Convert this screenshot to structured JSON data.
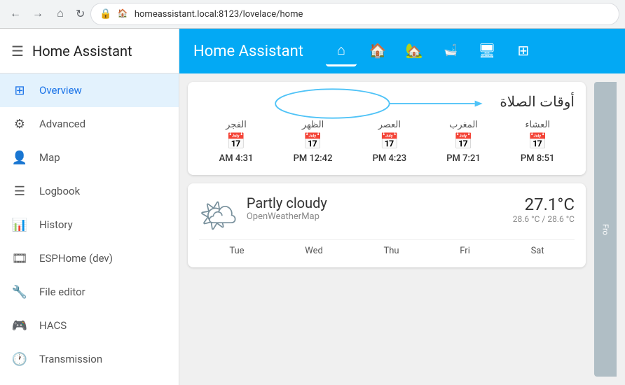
{
  "browser": {
    "back_disabled": false,
    "forward_disabled": true,
    "url": "homeassistant.local:8123/lovelace/home",
    "reload_icon": "↻"
  },
  "sidebar": {
    "title": "Home Assistant",
    "menu_icon": "☰",
    "items": [
      {
        "id": "overview",
        "label": "Overview",
        "icon": "⊞",
        "active": true
      },
      {
        "id": "advanced",
        "label": "Advanced",
        "icon": "⚙",
        "active": false
      },
      {
        "id": "map",
        "label": "Map",
        "icon": "👤",
        "active": false
      },
      {
        "id": "logbook",
        "label": "Logbook",
        "icon": "☰",
        "active": false
      },
      {
        "id": "history",
        "label": "History",
        "icon": "📊",
        "active": false
      },
      {
        "id": "esphome",
        "label": "ESPHome (dev)",
        "icon": "🎞",
        "active": false
      },
      {
        "id": "file-editor",
        "label": "File editor",
        "icon": "🔧",
        "active": false
      },
      {
        "id": "hacs",
        "label": "HACS",
        "icon": "🎮",
        "active": false
      },
      {
        "id": "transmission",
        "label": "Transmission",
        "icon": "🕐",
        "active": false
      }
    ]
  },
  "topbar": {
    "title": "Home Assistant",
    "tabs": [
      {
        "id": "home",
        "icon": "⌂",
        "active": true
      },
      {
        "id": "family",
        "icon": "🏠",
        "active": false
      },
      {
        "id": "house",
        "icon": "🏡",
        "active": false
      },
      {
        "id": "scenes",
        "icon": "🛁",
        "active": false
      },
      {
        "id": "media",
        "icon": "🖥",
        "active": false
      },
      {
        "id": "network",
        "icon": "⊞",
        "active": false
      }
    ]
  },
  "prayer_card": {
    "title": "أوقات الصلاة",
    "prayers": [
      {
        "name": "العشاء",
        "time": "8:51 PM"
      },
      {
        "name": "المغرب",
        "time": "7:21 PM"
      },
      {
        "name": "العصر",
        "time": "4:23 PM"
      },
      {
        "name": "الظهر",
        "time": "12:42 PM"
      },
      {
        "name": "الفجر",
        "time": "4:31 AM"
      }
    ]
  },
  "weather_card": {
    "condition": "Partly cloudy",
    "source": "OpenWeatherMap",
    "temperature": "27.1°C",
    "range": "28.6 °C / 28.6 °C",
    "days": [
      "Tue",
      "Wed",
      "Thu",
      "Fri",
      "Sat"
    ]
  },
  "right_panel": {
    "label": "Fro"
  },
  "colors": {
    "topbar": "#03a9f4",
    "active_sidebar": "#e3f2fd",
    "active_text": "#1a73e8"
  }
}
